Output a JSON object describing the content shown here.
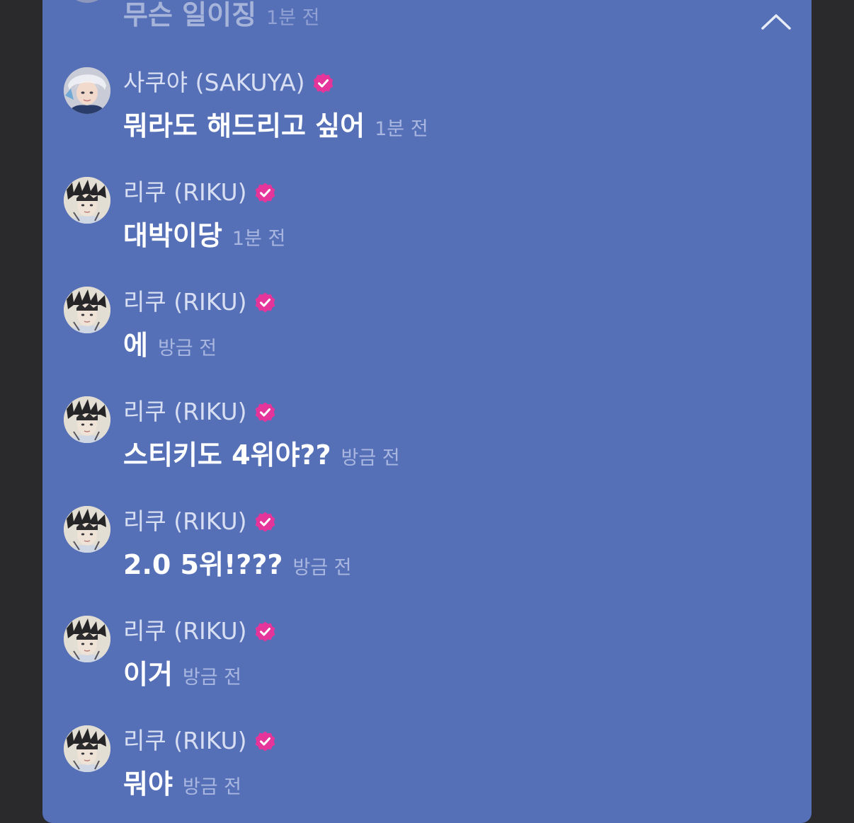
{
  "colors": {
    "panel_bg": "#5670b8",
    "outer_bg": "#2a2a2c",
    "name_text": "#d9dff2",
    "message_text": "#ffffff",
    "time_text": "#a9b7e0",
    "verified_badge": "#e6359a"
  },
  "header": {
    "collapse_icon": "chevron-up-icon"
  },
  "top_message": {
    "text": "무슨 일이징",
    "time": "1분 전"
  },
  "messages": [
    {
      "name": "사쿠야 (SAKUYA)",
      "verified": true,
      "text": "뭐라도 해드리고 싶어",
      "time": "1분 전",
      "avatar": "sakuya-avatar"
    },
    {
      "name": "리쿠 (RIKU)",
      "verified": true,
      "text": "대박이당",
      "time": "1분 전",
      "avatar": "riku-avatar"
    },
    {
      "name": "리쿠 (RIKU)",
      "verified": true,
      "text": "에",
      "time": "방금 전",
      "avatar": "riku-avatar"
    },
    {
      "name": "리쿠 (RIKU)",
      "verified": true,
      "text": "스티키도 4위야??",
      "time": "방금 전",
      "avatar": "riku-avatar"
    },
    {
      "name": "리쿠 (RIKU)",
      "verified": true,
      "text": "2.0 5위!???",
      "time": "방금 전",
      "avatar": "riku-avatar"
    },
    {
      "name": "리쿠 (RIKU)",
      "verified": true,
      "text": "이거",
      "time": "방금 전",
      "avatar": "riku-avatar"
    },
    {
      "name": "리쿠 (RIKU)",
      "verified": true,
      "text": "뭐야",
      "time": "방금 전",
      "avatar": "riku-avatar"
    }
  ]
}
